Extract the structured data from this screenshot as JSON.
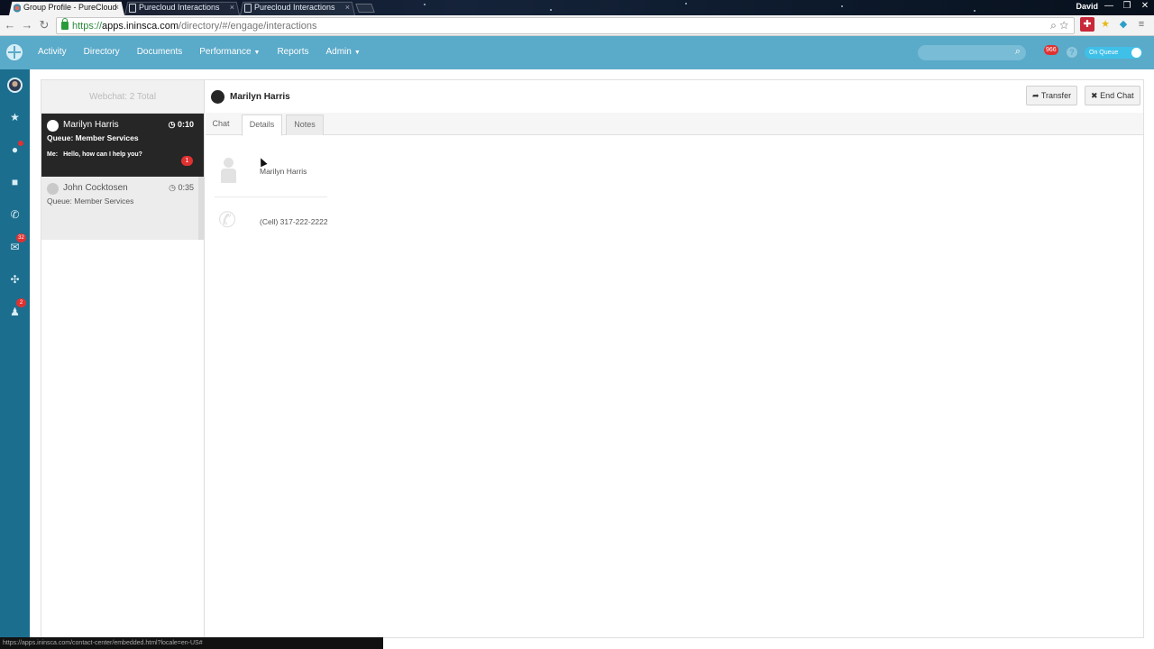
{
  "browser": {
    "tabs": [
      {
        "title": "Group Profile - PureCloud",
        "close": "×"
      },
      {
        "title": "Purecloud Interactions",
        "close": "×"
      },
      {
        "title": "Purecloud Interactions",
        "close": "×"
      }
    ],
    "user": "David",
    "window_buttons": {
      "minimize": "—",
      "restore": "❐",
      "close": "✕"
    },
    "url": {
      "scheme": "https://",
      "host": "apps.ininsca.com",
      "path": "/directory/#/engage/interactions"
    },
    "status_url": "https://apps.ininsca.com/contact-center/embedded.html?locale=en-US#"
  },
  "app": {
    "nav": {
      "activity": "Activity",
      "directory": "Directory",
      "documents": "Documents",
      "performance": "Performance",
      "reports": "Reports",
      "admin": "Admin"
    },
    "header_badge": "966",
    "queue_toggle": "On Queue"
  },
  "rail": {
    "email_badge": "32",
    "group_badge": "2"
  },
  "list": {
    "header": "Webchat: 2 Total",
    "conversations": [
      {
        "name": "Marilyn Harris",
        "timer": "0:10",
        "queue": "Queue: Member Services",
        "msg_sender": "Me:",
        "msg_text": "Hello, how can I help you?",
        "unread": "1"
      },
      {
        "name": "John Cocktosen",
        "timer": "0:35",
        "queue": "Queue: Member Services"
      }
    ]
  },
  "detail": {
    "name": "Marilyn Harris",
    "transfer_label": "Transfer",
    "end_chat_label": "End Chat",
    "tabs": {
      "chat": "Chat",
      "details": "Details",
      "notes": "Notes"
    },
    "contact_name": "Marilyn Harris",
    "contact_phone": "(Cell) 317-222-2222"
  },
  "colors": {
    "header_bg": "#5aaac9",
    "rail_bg": "#1c6e8e",
    "active_conv": "#262626",
    "badge": "#e03131",
    "queue_toggle": "#3fc0e8"
  }
}
